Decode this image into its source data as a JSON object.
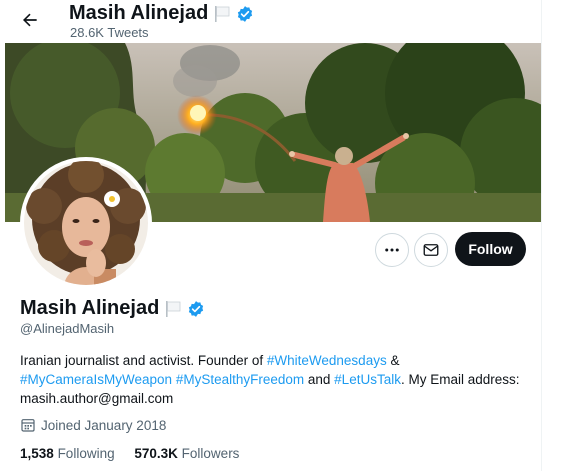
{
  "header": {
    "name": "Masih Alinejad",
    "tweet_count": "28.6K Tweets"
  },
  "profile": {
    "display_name": "Masih Alinejad",
    "handle": "@AlinejadMasih",
    "follow_label": "Follow",
    "bio": {
      "t1": "Iranian journalist and activist. Founder of ",
      "tag1": "#WhiteWednesdays",
      "t2": " &",
      "tag2": "#MyCameraIsMyWeapon",
      "t3": " ",
      "tag3": "#MyStealthyFreedom",
      "t4": " and ",
      "tag4": "#LetUsTalk",
      "t5": ". My Email address: masih.author@gmail.com"
    },
    "joined": "Joined January 2018",
    "following_count": "1,538",
    "following_label": "Following",
    "followers_count": "570.3K",
    "followers_label": "Followers"
  },
  "colors": {
    "accent": "#1d9bf0",
    "text": "#0f1419",
    "muted": "#536471",
    "verified": "#1d9bf0"
  },
  "icons": {
    "back": "arrow-left-icon",
    "flag": "white-flag-icon",
    "verified": "verified-badge-icon",
    "more": "more-horizontal-icon",
    "message": "envelope-icon",
    "calendar": "calendar-icon"
  }
}
